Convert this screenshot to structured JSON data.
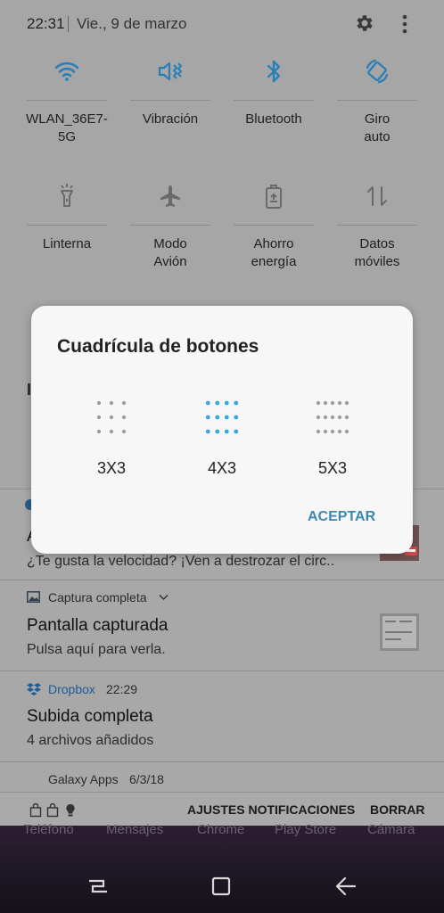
{
  "status": {
    "time": "22:31",
    "date": "Vie., 9 de marzo"
  },
  "tiles": [
    {
      "icon": "wifi-icon",
      "label": "WLAN_36E7-\n5G",
      "active": true
    },
    {
      "icon": "vibrate-icon",
      "label": "Vibración",
      "active": true
    },
    {
      "icon": "bluetooth-icon",
      "label": "Bluetooth",
      "active": true
    },
    {
      "icon": "rotate-icon",
      "label": "Giro\nauto",
      "active": true
    },
    {
      "icon": "flashlight-icon",
      "label": "Linterna",
      "active": false
    },
    {
      "icon": "airplane-icon",
      "label": "Modo\nAvión",
      "active": false
    },
    {
      "icon": "battery-saver-icon",
      "label": "Ahorro\nenergía",
      "active": false
    },
    {
      "icon": "mobile-data-icon",
      "label": "Datos\nmóviles",
      "active": false
    }
  ],
  "notifications": [
    {
      "title_partial": "A",
      "body": "¿Te gusta la velocidad? ¡Ven a destrozar el circ.."
    },
    {
      "app": "Captura completa",
      "title": "Pantalla capturada",
      "body": "Pulsa aquí para verla."
    },
    {
      "app": "Dropbox",
      "time": "22:29",
      "title": "Subida completa",
      "body": "4 archivos añadidos"
    },
    {
      "app": "Galaxy Apps",
      "time": "6/3/18"
    }
  ],
  "bottom_actions": {
    "settings": "AJUSTES NOTIFICACIONES",
    "clear": "BORRAR"
  },
  "dock": [
    "Teléfono",
    "Mensajes",
    "Chrome",
    "Play Store",
    "Cámara"
  ],
  "dialog": {
    "title": "Cuadrícula de botones",
    "options": [
      {
        "label": "3X3",
        "cols": 3,
        "selected": false
      },
      {
        "label": "4X3",
        "cols": 4,
        "selected": true
      },
      {
        "label": "5X3",
        "cols": 5,
        "selected": false
      }
    ],
    "accept": "ACEPTAR"
  },
  "colors": {
    "active": "#2c7fb6",
    "inactive": "#6a6a6a",
    "dot_selected": "#3aa6e0",
    "dot_inactive": "#9a9a9a"
  }
}
